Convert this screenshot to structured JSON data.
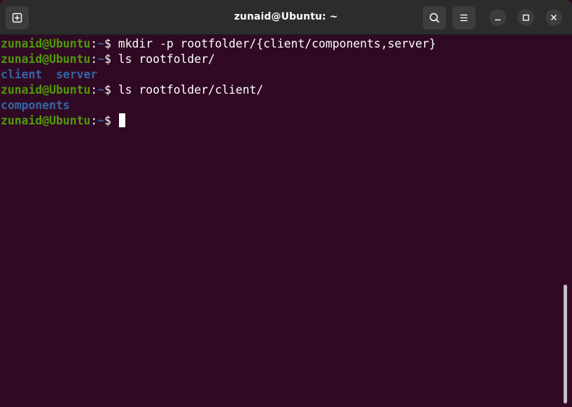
{
  "window": {
    "title": "zunaid@Ubuntu: ~",
    "buttons": {
      "new_tab_icon": "new-tab-icon",
      "search_icon": "search-icon",
      "menu_icon": "hamburger-menu-icon",
      "minimize_icon": "minimize-icon",
      "maximize_icon": "maximize-icon",
      "close_icon": "close-icon"
    }
  },
  "colors": {
    "background": "#300a24",
    "prompt_user": "#4e9a06",
    "prompt_path": "#3465a4",
    "directory": "#3465a4",
    "text": "#ffffff",
    "titlebar": "#2c2c2c"
  },
  "terminal": {
    "prompt": {
      "user_host": "zunaid@Ubuntu",
      "separator": ":",
      "path": "~",
      "symbol": "$ "
    },
    "lines": {
      "cmd1": "mkdir -p rootfolder/{client/components,server}",
      "cmd2": "ls rootfolder/",
      "out2_a": "client",
      "out2_gap": "  ",
      "out2_b": "server",
      "cmd3": "ls rootfolder/client/",
      "out3_a": "components"
    }
  },
  "scroll": {
    "position_fraction": 1.0
  }
}
